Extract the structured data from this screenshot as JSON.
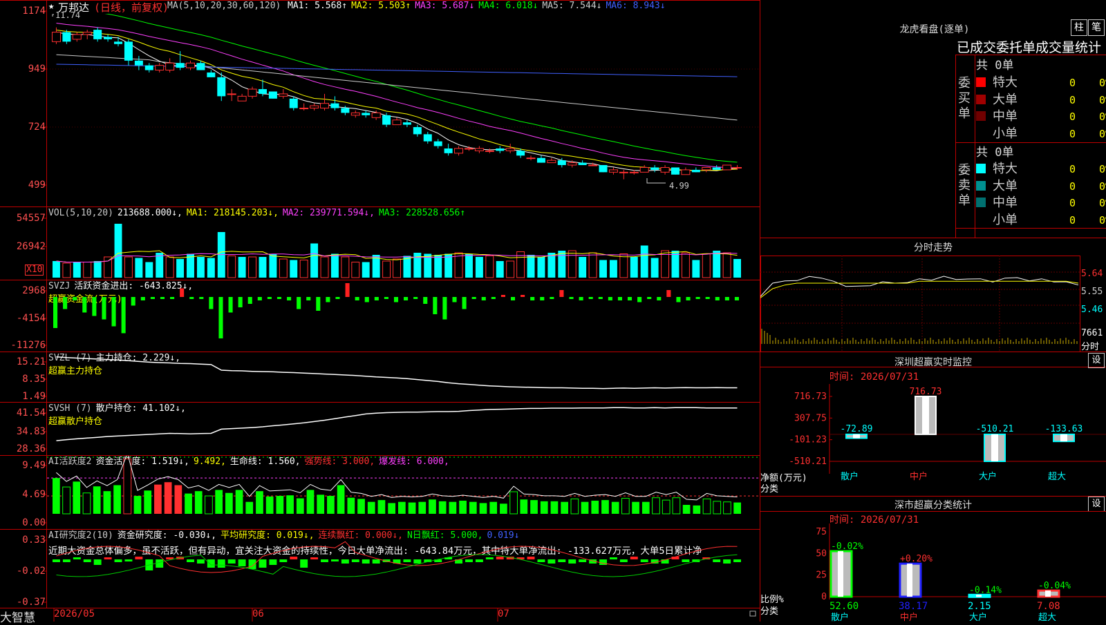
{
  "main_chart": {
    "star": "★",
    "stock_name": "万邦达",
    "period": "(日线，前复权)",
    "ma_header": "MA(5,10,20,30,60,120)",
    "ma_values": [
      {
        "label": "MA1: 5.568↑",
        "color": "#ffffff"
      },
      {
        "label": "MA2: 5.503↑",
        "color": "#ffff00"
      },
      {
        "label": "MA3: 5.687↓",
        "color": "#ff40ff"
      },
      {
        "label": "MA4: 6.018↓",
        "color": "#00ff00"
      },
      {
        "label": "MA5: 7.544↓",
        "color": "#cccccc"
      },
      {
        "label": "MA6: 8.943↓",
        "color": "#4060ff"
      }
    ],
    "high_label": "11.74",
    "low_label": "4.99",
    "y_ticks": [
      "1174",
      "949",
      "724",
      "499"
    ],
    "candles": [
      [
        10.8,
        11.4,
        10.7,
        11.2
      ],
      [
        11.2,
        11.3,
        10.7,
        10.8
      ],
      [
        10.9,
        11.2,
        10.8,
        11.1
      ],
      [
        11.1,
        11.3,
        10.9,
        11.2
      ],
      [
        11.3,
        11.4,
        10.8,
        10.9
      ],
      [
        11.0,
        11.1,
        10.8,
        10.9
      ],
      [
        10.8,
        11.0,
        10.6,
        10.7
      ],
      [
        10.8,
        10.9,
        9.8,
        10.0
      ],
      [
        10.0,
        10.2,
        9.6,
        9.8
      ],
      [
        9.8,
        9.9,
        9.5,
        9.6
      ],
      [
        9.6,
        9.9,
        9.5,
        9.8
      ],
      [
        9.6,
        10.1,
        9.5,
        9.9
      ],
      [
        9.9,
        10.4,
        9.6,
        9.7
      ],
      [
        9.7,
        10.0,
        9.6,
        9.9
      ],
      [
        9.9,
        10.0,
        9.6,
        9.6
      ],
      [
        9.5,
        9.6,
        9.3,
        9.3
      ],
      [
        9.3,
        9.5,
        8.3,
        8.5
      ],
      [
        8.6,
        8.8,
        8.3,
        8.6
      ],
      [
        8.3,
        8.6,
        8.3,
        8.5
      ],
      [
        8.5,
        8.9,
        8.4,
        8.8
      ],
      [
        8.8,
        9.2,
        8.5,
        8.6
      ],
      [
        8.7,
        8.7,
        8.4,
        8.4
      ],
      [
        8.5,
        8.8,
        8.4,
        8.6
      ],
      [
        8.4,
        8.5,
        7.9,
        8.0
      ],
      [
        8.0,
        8.2,
        7.9,
        8.0
      ],
      [
        8.0,
        8.2,
        7.9,
        8.1
      ],
      [
        8.0,
        8.6,
        7.9,
        8.2
      ],
      [
        8.2,
        8.5,
        7.9,
        8.0
      ],
      [
        8.0,
        8.1,
        7.7,
        7.8
      ],
      [
        7.7,
        7.9,
        7.6,
        7.8
      ],
      [
        7.8,
        7.9,
        7.6,
        7.7
      ],
      [
        7.6,
        7.9,
        7.5,
        7.8
      ],
      [
        7.7,
        7.8,
        7.2,
        7.3
      ],
      [
        7.3,
        7.6,
        7.3,
        7.5
      ],
      [
        7.4,
        7.5,
        7.2,
        7.3
      ],
      [
        7.2,
        7.3,
        6.8,
        6.9
      ],
      [
        6.9,
        7.0,
        6.5,
        6.6
      ],
      [
        6.6,
        6.7,
        6.3,
        6.4
      ],
      [
        6.3,
        6.5,
        6.0,
        6.1
      ],
      [
        6.1,
        6.4,
        6.0,
        6.3
      ],
      [
        6.3,
        6.4,
        6.2,
        6.3
      ],
      [
        6.2,
        6.4,
        6.1,
        6.3
      ],
      [
        6.2,
        6.3,
        6.1,
        6.2
      ],
      [
        6.3,
        6.4,
        6.1,
        6.2
      ],
      [
        6.2,
        6.5,
        6.1,
        6.3
      ],
      [
        6.2,
        6.3,
        5.9,
        6.0
      ],
      [
        5.9,
        6.0,
        5.8,
        5.9
      ],
      [
        5.9,
        6.0,
        5.7,
        5.7
      ],
      [
        5.7,
        5.9,
        5.7,
        5.8
      ],
      [
        5.8,
        5.9,
        5.5,
        5.6
      ],
      [
        5.6,
        5.8,
        5.5,
        5.7
      ],
      [
        5.7,
        5.8,
        5.6,
        5.6
      ],
      [
        5.6,
        5.7,
        5.6,
        5.6
      ],
      [
        5.6,
        5.6,
        5.3,
        5.3
      ],
      [
        5.3,
        5.5,
        5.2,
        5.4
      ],
      [
        5.3,
        5.4,
        5.0,
        5.3
      ],
      [
        5.3,
        5.4,
        5.2,
        5.3
      ],
      [
        5.3,
        5.6,
        5.3,
        5.5
      ],
      [
        5.5,
        5.6,
        5.3,
        5.4
      ],
      [
        5.3,
        5.6,
        5.2,
        5.5
      ],
      [
        5.5,
        5.5,
        5.2,
        5.2
      ],
      [
        5.2,
        5.5,
        5.2,
        5.4
      ],
      [
        5.4,
        5.5,
        5.3,
        5.3
      ],
      [
        5.4,
        5.5,
        5.3,
        5.5
      ],
      [
        5.5,
        5.6,
        5.4,
        5.4
      ],
      [
        5.4,
        5.6,
        5.4,
        5.6
      ],
      [
        5.5,
        5.6,
        5.4,
        5.5
      ]
    ]
  },
  "vol_panel": {
    "header": [
      {
        "label": "VOL(5,10,20)",
        "color": "#cccccc"
      },
      {
        "label": "213688.000↓,",
        "color": "#ffffff"
      },
      {
        "label": "MA1: 218145.203↓,",
        "color": "#ffff00"
      },
      {
        "label": "MA2: 239771.594↓,",
        "color": "#ff40ff"
      },
      {
        "label": "MA3: 228528.656↑",
        "color": "#00ff00"
      }
    ],
    "y_ticks": [
      "54557",
      "26942"
    ],
    "unit": "X10",
    "bars": [
      [
        16,
        1
      ],
      [
        14,
        0
      ],
      [
        15,
        1
      ],
      [
        15,
        0
      ],
      [
        16,
        1
      ],
      [
        20,
        0
      ],
      [
        52,
        1
      ],
      [
        20,
        0
      ],
      [
        19,
        1
      ],
      [
        15,
        1
      ],
      [
        24,
        1
      ],
      [
        20,
        0
      ],
      [
        18,
        1
      ],
      [
        23,
        1
      ],
      [
        20,
        1
      ],
      [
        19,
        1
      ],
      [
        44,
        1
      ],
      [
        21,
        0
      ],
      [
        20,
        1
      ],
      [
        20,
        0
      ],
      [
        20,
        1
      ],
      [
        23,
        1
      ],
      [
        18,
        0
      ],
      [
        17,
        1
      ],
      [
        17,
        0
      ],
      [
        33,
        1
      ],
      [
        20,
        0
      ],
      [
        23,
        1
      ],
      [
        20,
        0
      ],
      [
        15,
        0
      ],
      [
        15,
        1
      ],
      [
        22,
        1
      ],
      [
        16,
        0
      ],
      [
        18,
        0
      ],
      [
        21,
        1
      ],
      [
        24,
        1
      ],
      [
        23,
        1
      ],
      [
        22,
        1
      ],
      [
        23,
        1
      ],
      [
        24,
        0
      ],
      [
        23,
        1
      ],
      [
        20,
        1
      ],
      [
        21,
        0
      ],
      [
        16,
        1
      ],
      [
        16,
        0
      ],
      [
        25,
        0
      ],
      [
        22,
        1
      ],
      [
        20,
        1
      ],
      [
        24,
        1
      ],
      [
        26,
        1
      ],
      [
        26,
        0
      ],
      [
        20,
        1
      ],
      [
        24,
        0
      ],
      [
        17,
        1
      ],
      [
        17,
        1
      ],
      [
        23,
        0
      ],
      [
        20,
        1
      ],
      [
        31,
        1
      ],
      [
        19,
        1
      ],
      [
        26,
        0
      ],
      [
        26,
        1
      ],
      [
        24,
        0
      ],
      [
        17,
        1
      ],
      [
        23,
        0
      ],
      [
        26,
        1
      ],
      [
        24,
        0
      ],
      [
        18,
        1
      ]
    ]
  },
  "svzj_panel": {
    "header": [
      {
        "label": "SVZJ",
        "color": "#cccccc"
      },
      {
        "label": "活跃资金进出: -643.825↓,",
        "color": "#ffffff"
      }
    ],
    "subtitle": "超赢资金流(万元)",
    "y_ticks": [
      "2968",
      "-4154",
      "-11276"
    ],
    "bars": [
      -1800,
      -700,
      -200,
      -900,
      -1100,
      -1300,
      -1700,
      -2100,
      -500,
      -200,
      -100,
      0,
      -100,
      500,
      -100,
      -100,
      -700,
      -2400,
      -900,
      -600,
      -400,
      -200,
      -100,
      -100,
      -200,
      -700,
      -200,
      -800,
      -300,
      -100,
      800,
      -200,
      -300,
      -200,
      -100,
      -300,
      -200,
      -100,
      -400,
      -1000,
      -1300,
      -300,
      -700,
      -100,
      -200,
      -100,
      100,
      -200,
      100,
      -200,
      -200,
      -100,
      400,
      -100,
      -200,
      -100,
      -100,
      -200,
      -200,
      -200,
      -300,
      -100,
      -200,
      400,
      -300,
      -200,
      -100,
      -100,
      -200,
      -200,
      -200
    ]
  },
  "svzl_panel": {
    "header": [
      {
        "label": "SVZL (7)",
        "color": "#cccccc"
      },
      {
        "label": "主力持仓: 2.229↓,",
        "color": "#ffffff"
      }
    ],
    "subtitle": "超赢主力持仓",
    "y_ticks": [
      "15.21",
      "8.35",
      "1.49"
    ],
    "line": [
      15.0,
      14.7,
      14.5,
      14.3,
      14.1,
      13.9,
      13.7,
      13.4,
      13.1,
      12.8,
      12.6,
      12.5,
      12.3,
      12.2,
      12.0,
      11.8,
      9.5,
      9.3,
      9.2,
      9.0,
      8.9,
      8.8,
      8.6,
      8.5,
      8.3,
      8.1,
      7.9,
      7.7,
      7.5,
      7.3,
      7.0,
      6.7,
      6.5,
      6.3,
      6.0,
      5.6,
      5.2,
      4.8,
      4.3,
      3.9,
      3.6,
      3.3,
      3.0,
      2.8,
      2.6,
      2.5,
      2.4,
      2.3,
      2.2,
      2.2,
      2.1,
      2.0,
      2.0,
      1.9,
      2.0,
      2.1,
      2.0,
      2.1,
      2.2,
      2.1,
      2.2,
      2.3,
      2.2,
      2.2,
      2.3,
      2.2,
      2.2
    ]
  },
  "svsh_panel": {
    "header": [
      {
        "label": "SVSH (7)",
        "color": "#cccccc"
      },
      {
        "label": "散户持仓: 41.102↓,",
        "color": "#ffffff"
      }
    ],
    "subtitle": "超赢散户持仓",
    "y_ticks": [
      "41.54",
      "34.83",
      "28.36"
    ],
    "line": [
      28.6,
      29.0,
      29.3,
      29.6,
      29.9,
      30.2,
      30.4,
      30.6,
      30.8,
      31.0,
      31.2,
      31.4,
      31.3,
      31.2,
      31.3,
      31.4,
      33.0,
      33.2,
      33.4,
      33.6,
      33.9,
      34.3,
      34.6,
      35.0,
      35.4,
      35.9,
      36.4,
      37.0,
      37.6,
      38.2,
      38.8,
      39.1,
      39.3,
      39.4,
      39.5,
      39.5,
      39.6,
      39.7,
      39.7,
      39.8,
      40.1,
      40.3,
      40.5,
      40.6,
      40.7,
      40.8,
      40.9,
      40.9,
      41.0,
      41.0,
      41.0,
      41.1,
      41.1,
      41.1,
      41.2,
      41.2,
      41.1,
      41.1,
      41.2,
      41.1,
      41.2,
      41.2,
      41.2,
      41.1,
      41.1,
      41.1,
      41.1
    ]
  },
  "ai_active_panel": {
    "header": [
      {
        "label": "AI活跃度2",
        "color": "#cccccc"
      },
      {
        "label": "资金活跃度: 1.519↓,",
        "color": "#ffffff"
      },
      {
        "label": "9.492,",
        "color": "#ffff00"
      },
      {
        "label": "生命线: 1.560,",
        "color": "#ffffff"
      },
      {
        "label": "强势线: 3.000,",
        "color": "#ff3030"
      },
      {
        "label": "爆发线: 6.000,",
        "color": "#ff40ff"
      }
    ],
    "y_ticks": [
      "9.49",
      "4.69",
      "0.00"
    ],
    "bars": [
      [
        6.0,
        1
      ],
      [
        4.5,
        0
      ],
      [
        5.4,
        1
      ],
      [
        3.5,
        0
      ],
      [
        4.6,
        1
      ],
      [
        3.8,
        1
      ],
      [
        4.8,
        1
      ],
      [
        9.2,
        2
      ],
      [
        3.0,
        1
      ],
      [
        3.9,
        1
      ],
      [
        4.9,
        3
      ],
      [
        5.3,
        3
      ],
      [
        4.8,
        3
      ],
      [
        3.4,
        1
      ],
      [
        3.8,
        1
      ],
      [
        3.0,
        0
      ],
      [
        4.0,
        1
      ],
      [
        3.5,
        1
      ],
      [
        4.0,
        1
      ],
      [
        2.0,
        1
      ],
      [
        3.8,
        1
      ],
      [
        2.9,
        1
      ],
      [
        3.0,
        1
      ],
      [
        3.1,
        1
      ],
      [
        2.6,
        1
      ],
      [
        4.0,
        1
      ],
      [
        3.2,
        1
      ],
      [
        3.0,
        1
      ],
      [
        4.8,
        1
      ],
      [
        2.7,
        1
      ],
      [
        2.5,
        1
      ],
      [
        2.0,
        1
      ],
      [
        2.3,
        1
      ],
      [
        1.8,
        1
      ],
      [
        2.0,
        1
      ],
      [
        1.9,
        1
      ],
      [
        2.0,
        1
      ],
      [
        2.4,
        1
      ],
      [
        2.1,
        1
      ],
      [
        2.0,
        1
      ],
      [
        2.2,
        1
      ],
      [
        2.0,
        1
      ],
      [
        1.8,
        1
      ],
      [
        2.0,
        1
      ],
      [
        1.7,
        1
      ],
      [
        3.7,
        0
      ],
      [
        2.4,
        1
      ],
      [
        2.3,
        1
      ],
      [
        2.1,
        1
      ],
      [
        2.1,
        1
      ],
      [
        2.0,
        1
      ],
      [
        2.5,
        0
      ],
      [
        2.0,
        1
      ],
      [
        2.2,
        1
      ],
      [
        2.3,
        1
      ],
      [
        2.0,
        1
      ],
      [
        2.6,
        0
      ],
      [
        2.0,
        1
      ],
      [
        2.0,
        1
      ],
      [
        2.7,
        0
      ],
      [
        2.3,
        0
      ],
      [
        2.7,
        0
      ],
      [
        1.5,
        1
      ],
      [
        1.4,
        1
      ],
      [
        2.5,
        0
      ],
      [
        2.1,
        0
      ],
      [
        2.0,
        0
      ],
      [
        1.9,
        1
      ]
    ]
  },
  "ai_research_panel": {
    "header": [
      {
        "label": "AI研究度2(10)",
        "color": "#cccccc"
      },
      {
        "label": "资金研究度: -0.030↓,",
        "color": "#ffffff"
      },
      {
        "label": "平均研究度: 0.019↓,",
        "color": "#ffff00"
      },
      {
        "label": "连续飘红: 0.000↓,",
        "color": "#ff3030"
      },
      {
        "label": "N日飘红: 5.000,",
        "color": "#00ff00"
      },
      {
        "label": "0.019↓",
        "color": "#4060ff"
      }
    ],
    "commentary": "近期大资金总体偏多，虽不活跃，但有异动，宜关注大资金的持续性，今日大单净流出: -643.84万元，其中特大单净流出: -133.627万元，大单5日累计净",
    "y_ticks": [
      "0.33",
      "-0.02",
      "-0.37"
    ],
    "bars": [
      -0.02,
      -0.02,
      0.0,
      -0.02,
      -0.04,
      0.01,
      -0.02,
      -0.01,
      0.02,
      -0.08,
      -0.06,
      0.01,
      0.02,
      -0.02,
      -0.03,
      -0.06,
      -0.06,
      -0.03,
      -0.05,
      -0.07,
      -0.06,
      -0.04,
      -0.02,
      0.02,
      -0.06,
      0.01,
      -0.02,
      -0.01,
      -0.03,
      -0.02,
      -0.03,
      -0.03,
      -0.02,
      -0.03,
      -0.02,
      -0.03,
      -0.02,
      -0.02,
      0.0,
      -0.03,
      -0.02,
      -0.02,
      0.0,
      0.02,
      0.02,
      0.01,
      0.02,
      -0.02,
      -0.03,
      -0.02,
      -0.03,
      -0.02,
      -0.03,
      -0.04,
      0.0,
      -0.02,
      0.02,
      -0.02,
      -0.03,
      -0.03,
      0.02,
      -0.02,
      -0.02,
      0.01,
      -0.02,
      -0.03,
      -0.02
    ]
  },
  "date_axis": {
    "logo": "大智慧",
    "labels": [
      "2026/05",
      "06",
      "07"
    ]
  },
  "dragon_tiger": {
    "title": "龙虎看盘(逐单)",
    "btn_column": "柱",
    "btn_detail": "笔",
    "subtitle": "已成交委托单成交量统计",
    "buy_label": "委买单",
    "sell_label": "委卖单",
    "buy_total": "共 0单",
    "sell_total": "共 0单",
    "buy_rows": [
      {
        "name": "特大",
        "count": "0",
        "pct": "0%",
        "color": "#ff0000"
      },
      {
        "name": "大单",
        "count": "0",
        "pct": "0%",
        "color": "#a00000"
      },
      {
        "name": "中单",
        "count": "0",
        "pct": "0%",
        "color": "#700000"
      },
      {
        "name": "小单",
        "count": "0",
        "pct": "0%",
        "color": "#000000"
      }
    ],
    "sell_rows": [
      {
        "name": "特大",
        "count": "0",
        "pct": "0%",
        "color": "#00ffff"
      },
      {
        "name": "大单",
        "count": "0",
        "pct": "0%",
        "color": "#009090"
      },
      {
        "name": "中单",
        "count": "0",
        "pct": "0%",
        "color": "#007070"
      },
      {
        "name": "小单",
        "count": "0",
        "pct": "0%",
        "color": "#000000"
      }
    ]
  },
  "intraday": {
    "title": "分时走势",
    "y_ticks": [
      "5.64",
      "5.55",
      "5.46"
    ],
    "vol_tick": "7661",
    "vol_label": "分时",
    "price_line": [
      5.5,
      5.58,
      5.6,
      5.59,
      5.62,
      5.6,
      5.59,
      5.57,
      5.56,
      5.57,
      5.58,
      5.58,
      5.59,
      5.6,
      5.6,
      5.61,
      5.6,
      5.61,
      5.6,
      5.59,
      5.6,
      5.61,
      5.6,
      5.6,
      5.59,
      5.58,
      5.57
    ],
    "avg_line": [
      5.5,
      5.55,
      5.57,
      5.58,
      5.58,
      5.58,
      5.58,
      5.58,
      5.58,
      5.58,
      5.58,
      5.58,
      5.58,
      5.59,
      5.59,
      5.59,
      5.59,
      5.59,
      5.59,
      5.59,
      5.59,
      5.59,
      5.59,
      5.59,
      5.59,
      5.59,
      5.58
    ]
  },
  "sz_monitor": {
    "title": "深圳超赢实时监控",
    "btn": "设",
    "time_label": "时间: 2026/07/31",
    "y_ticks": [
      "716.73",
      "307.75",
      "-101.23",
      "-510.21"
    ],
    "y_name": "净额(万元)",
    "x_name": "分类",
    "categories": [
      "散户",
      "中户",
      "大户",
      "超大"
    ],
    "values": [
      -72.89,
      716.73,
      -510.21,
      -133.63
    ],
    "value_labels": [
      "-72.89",
      "716.73",
      "-510.21",
      "-133.63"
    ]
  },
  "sz_classify": {
    "title": "深市超赢分类统计",
    "btn": "设",
    "time_label": "时间: 2026/07/31",
    "y_ticks": [
      "75",
      "50",
      "25",
      "0"
    ],
    "y_name": "比例%",
    "x_name": "分类",
    "categories": [
      "散户",
      "中户",
      "大户",
      "超大"
    ],
    "values": [
      52.6,
      38.17,
      2.15,
      7.08
    ],
    "value_labels": [
      "52.60",
      "38.17",
      "2.15",
      "7.08"
    ],
    "changes": [
      "-0.02%",
      "+0.20%",
      "-0.14%",
      "-0.04%"
    ]
  },
  "colors": {
    "up": "#ff3030",
    "down": "#00ffff",
    "grid": "#c00000"
  }
}
